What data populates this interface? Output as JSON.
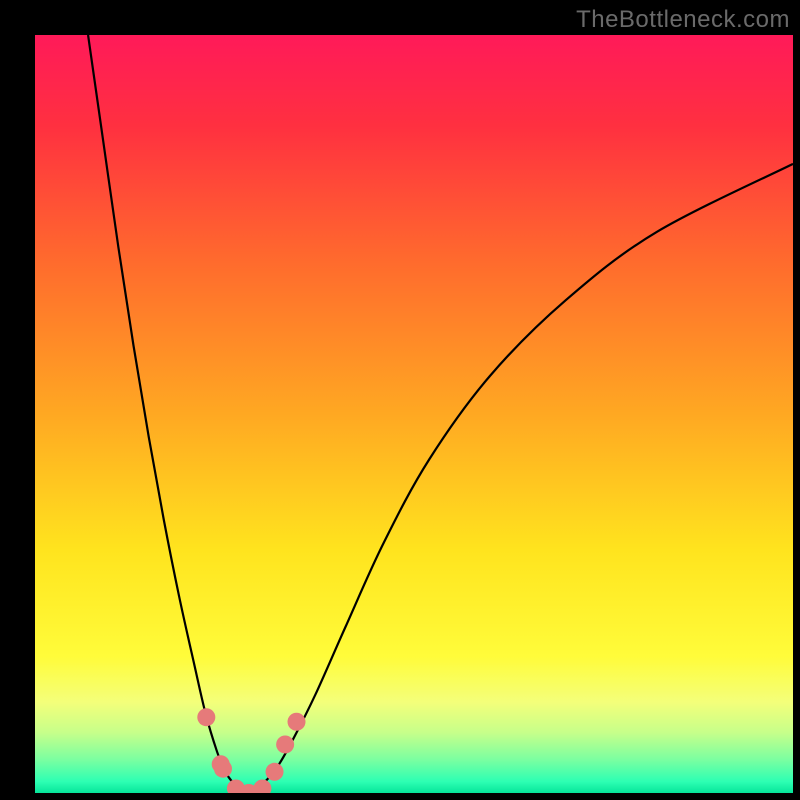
{
  "watermark": "TheBottleneck.com",
  "chart_data": {
    "type": "line",
    "title": "",
    "xlabel": "",
    "ylabel": "",
    "xlim": [
      0,
      100
    ],
    "ylim": [
      0,
      100
    ],
    "series": [
      {
        "name": "left-curve",
        "x": [
          7,
          9,
          11,
          13,
          15,
          17,
          19,
          21,
          22.5,
          24,
          25,
          26,
          27,
          28
        ],
        "y": [
          100,
          86,
          72,
          59,
          47,
          36,
          26,
          17,
          10.5,
          5.5,
          3,
          1.5,
          0.7,
          0.3
        ]
      },
      {
        "name": "right-curve",
        "x": [
          28,
          30,
          32,
          34,
          37,
          41,
          46,
          52,
          60,
          70,
          82,
          100
        ],
        "y": [
          0.3,
          1.2,
          3.5,
          7,
          13,
          22,
          33,
          44,
          55,
          65,
          74,
          83
        ]
      }
    ],
    "markers": {
      "name": "scatter-points",
      "color": "#e67a7a",
      "points": [
        {
          "x": 22.6,
          "y": 10.0
        },
        {
          "x": 24.5,
          "y": 3.8
        },
        {
          "x": 24.8,
          "y": 3.2
        },
        {
          "x": 26.5,
          "y": 0.6
        },
        {
          "x": 28.2,
          "y": 0.0
        },
        {
          "x": 30.0,
          "y": 0.6
        },
        {
          "x": 31.6,
          "y": 2.8
        },
        {
          "x": 33.0,
          "y": 6.4
        },
        {
          "x": 34.5,
          "y": 9.4
        }
      ]
    },
    "gradient_stops": [
      {
        "offset": 0.0,
        "color": "#ff1a59"
      },
      {
        "offset": 0.12,
        "color": "#ff3040"
      },
      {
        "offset": 0.3,
        "color": "#ff6b2d"
      },
      {
        "offset": 0.5,
        "color": "#ffa822"
      },
      {
        "offset": 0.68,
        "color": "#ffe41e"
      },
      {
        "offset": 0.82,
        "color": "#fffc3a"
      },
      {
        "offset": 0.88,
        "color": "#f4ff7a"
      },
      {
        "offset": 0.92,
        "color": "#c7ff8a"
      },
      {
        "offset": 0.955,
        "color": "#7dffa0"
      },
      {
        "offset": 0.985,
        "color": "#2dffb3"
      },
      {
        "offset": 1.0,
        "color": "#06e59a"
      }
    ],
    "green_band": {
      "from": 0,
      "to": 3.5
    }
  }
}
